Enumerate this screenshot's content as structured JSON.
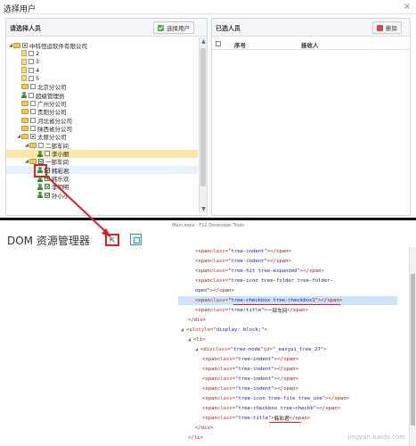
{
  "dialog": {
    "title": "选择用户",
    "close_glyph": "×",
    "left_panel": {
      "title": "请选择人员",
      "select_button_label": "选择用户",
      "tree": [
        {
          "label": "中科恒运软件有限公司",
          "level": 0,
          "type": "org",
          "expanded": true,
          "check": "partial"
        },
        {
          "label": "2",
          "level": 1,
          "type": "file",
          "check": "off"
        },
        {
          "label": "3",
          "level": 1,
          "type": "file",
          "check": "off"
        },
        {
          "label": "4",
          "level": 1,
          "type": "file",
          "check": "off"
        },
        {
          "label": "5",
          "level": 1,
          "type": "file",
          "check": "off"
        },
        {
          "label": "北京分公司",
          "level": 1,
          "type": "folder",
          "check": "off"
        },
        {
          "label": "超级管理员",
          "level": 1,
          "type": "user",
          "check": "off"
        },
        {
          "label": "广州分公司",
          "level": 1,
          "type": "folder",
          "check": "off"
        },
        {
          "label": "贵阳分公司",
          "level": 1,
          "type": "folder",
          "check": "off"
        },
        {
          "label": "河北省分公司",
          "level": 1,
          "type": "folder",
          "check": "off"
        },
        {
          "label": "陕西省分公司",
          "level": 1,
          "type": "folder",
          "check": "off"
        },
        {
          "label": "太原分公司",
          "level": 1,
          "type": "folder",
          "check": "partial",
          "expanded": true
        },
        {
          "label": "二部车间",
          "level": 2,
          "type": "folder",
          "check": "off",
          "expanded": true
        },
        {
          "label": "李小丽",
          "level": 3,
          "type": "user",
          "check": "off",
          "state": "selected"
        },
        {
          "label": "一部车间",
          "level": 2,
          "type": "folder",
          "check": "on",
          "expanded": true
        },
        {
          "label": "韩彩君",
          "level": 3,
          "type": "user",
          "check": "on",
          "state": "hover"
        },
        {
          "label": "韩乐欢",
          "level": 3,
          "type": "user",
          "check": "on"
        },
        {
          "label": "李明明",
          "level": 3,
          "type": "user",
          "check": "on"
        },
        {
          "label": "孙小小",
          "level": 3,
          "type": "user",
          "check": "on"
        }
      ]
    },
    "right_panel": {
      "title": "已选人员",
      "delete_button_label": "删除",
      "columns": [
        "序号",
        "接收人"
      ]
    }
  },
  "devtools": {
    "window_caption": "Main.aspx - F12 Developer Tools",
    "panel_title": "DOM 资源管理器",
    "select_element_glyph": "⇱",
    "lines": [
      {
        "indent": 0,
        "parts": [
          [
            "p",
            "<"
          ],
          [
            "t",
            "span"
          ],
          [
            "a",
            " class="
          ],
          [
            "v",
            "\"tree-indent\""
          ],
          [
            "p",
            "></"
          ],
          [
            "t",
            "span"
          ],
          [
            "p",
            ">"
          ]
        ]
      },
      {
        "indent": 0,
        "parts": [
          [
            "p",
            "<"
          ],
          [
            "t",
            "span"
          ],
          [
            "a",
            " class="
          ],
          [
            "v",
            "\"tree-indent\""
          ],
          [
            "p",
            "></"
          ],
          [
            "t",
            "span"
          ],
          [
            "p",
            ">"
          ]
        ]
      },
      {
        "indent": 0,
        "parts": [
          [
            "p",
            "<"
          ],
          [
            "t",
            "span"
          ],
          [
            "a",
            " class="
          ],
          [
            "v",
            "\"tree-hit tree-expanded\""
          ],
          [
            "p",
            "></"
          ],
          [
            "t",
            "span"
          ],
          [
            "p",
            ">"
          ]
        ]
      },
      {
        "indent": 0,
        "parts": [
          [
            "p",
            "<"
          ],
          [
            "t",
            "span"
          ],
          [
            "a",
            " class="
          ],
          [
            "v",
            "\"tree-icon tree-folder tree-folder-"
          ]
        ]
      },
      {
        "indent": 0,
        "parts": [
          [
            "v",
            "open\""
          ],
          [
            "p",
            "></"
          ],
          [
            "t",
            "span"
          ],
          [
            "p",
            ">"
          ]
        ]
      },
      {
        "indent": 0,
        "highlight": true,
        "parts": [
          [
            "p",
            "<"
          ],
          [
            "t",
            "span"
          ],
          [
            "a",
            " class="
          ],
          [
            "v",
            "\"tree-checkbox tree-checkbox1\""
          ],
          [
            "p",
            "></"
          ],
          [
            "t",
            "span"
          ],
          [
            "p",
            ">"
          ]
        ]
      },
      {
        "indent": 0,
        "parts": [
          [
            "p",
            "<"
          ],
          [
            "t",
            "span"
          ],
          [
            "a",
            " class="
          ],
          [
            "v",
            "\"tree-title\""
          ],
          [
            "p",
            ">"
          ],
          [
            "x",
            "一部车间"
          ],
          [
            "p",
            "</"
          ],
          [
            "t",
            "span"
          ],
          [
            "p",
            ">"
          ]
        ]
      },
      {
        "indent": -1,
        "parts": [
          [
            "p",
            "</"
          ],
          [
            "t",
            "div"
          ],
          [
            "p",
            ">"
          ]
        ]
      },
      {
        "indent": -2,
        "tri": "◢",
        "parts": [
          [
            "p",
            "<"
          ],
          [
            "t",
            "ul"
          ],
          [
            "a",
            " style="
          ],
          [
            "v",
            "\"display: block;\""
          ],
          [
            "p",
            ">"
          ]
        ]
      },
      {
        "indent": -1,
        "tri": "◢",
        "parts": [
          [
            "p",
            "<"
          ],
          [
            "t",
            "li"
          ],
          [
            "p",
            ">"
          ]
        ]
      },
      {
        "indent": 0,
        "tri": "◢",
        "parts": [
          [
            "p",
            "<"
          ],
          [
            "t",
            "div"
          ],
          [
            "a",
            " class="
          ],
          [
            "v",
            "\"tree-node\""
          ],
          [
            "a",
            " id="
          ],
          [
            "v",
            "\"_easyui_tree_27\""
          ],
          [
            "p",
            ">"
          ]
        ]
      },
      {
        "indent": 1,
        "parts": [
          [
            "p",
            "<"
          ],
          [
            "t",
            "span"
          ],
          [
            "a",
            " class="
          ],
          [
            "v",
            "\"tree-indent\""
          ],
          [
            "p",
            "></"
          ],
          [
            "t",
            "span"
          ],
          [
            "p",
            ">"
          ]
        ]
      },
      {
        "indent": 1,
        "parts": [
          [
            "p",
            "<"
          ],
          [
            "t",
            "span"
          ],
          [
            "a",
            " class="
          ],
          [
            "v",
            "\"tree-indent\""
          ],
          [
            "p",
            "></"
          ],
          [
            "t",
            "span"
          ],
          [
            "p",
            ">"
          ]
        ]
      },
      {
        "indent": 1,
        "parts": [
          [
            "p",
            "<"
          ],
          [
            "t",
            "span"
          ],
          [
            "a",
            " class="
          ],
          [
            "v",
            "\"tree-indent\""
          ],
          [
            "p",
            "></"
          ],
          [
            "t",
            "span"
          ],
          [
            "p",
            ">"
          ]
        ]
      },
      {
        "indent": 1,
        "parts": [
          [
            "p",
            "<"
          ],
          [
            "t",
            "span"
          ],
          [
            "a",
            " class="
          ],
          [
            "v",
            "\"tree-indent\""
          ],
          [
            "p",
            "></"
          ],
          [
            "t",
            "span"
          ],
          [
            "p",
            ">"
          ]
        ]
      },
      {
        "indent": 1,
        "parts": [
          [
            "p",
            "<"
          ],
          [
            "t",
            "span"
          ],
          [
            "a",
            " class="
          ],
          [
            "v",
            "\"tree-icon tree-file tree_use\""
          ],
          [
            "p",
            "></"
          ],
          [
            "t",
            "span"
          ],
          [
            "p",
            ">"
          ]
        ]
      },
      {
        "indent": 1,
        "parts": [
          [
            "p",
            "<"
          ],
          [
            "t",
            "span"
          ],
          [
            "a",
            " class="
          ],
          [
            "v",
            "\"tree-checkbox tree-checkb\""
          ],
          [
            "p",
            "></"
          ],
          [
            "t",
            "span"
          ],
          [
            "p",
            ">"
          ]
        ]
      },
      {
        "indent": 1,
        "parts": [
          [
            "p",
            "<"
          ],
          [
            "t",
            "span"
          ],
          [
            "a",
            " class="
          ],
          [
            "v",
            "\"tree-title\""
          ],
          [
            "p",
            ">"
          ],
          [
            "x",
            "韩彩君"
          ],
          [
            "p",
            "</"
          ],
          [
            "t",
            "span"
          ],
          [
            "p",
            ">"
          ]
        ]
      },
      {
        "indent": 0,
        "parts": [
          [
            "p",
            "</"
          ],
          [
            "t",
            "div"
          ],
          [
            "p",
            ">"
          ]
        ]
      },
      {
        "indent": -1,
        "parts": [
          [
            "p",
            "</"
          ],
          [
            "t",
            "li"
          ],
          [
            "p",
            ">"
          ]
        ]
      }
    ]
  },
  "annotation": {
    "arrow_color": "#e02020",
    "watermark": "jingyan.baidu.com"
  }
}
